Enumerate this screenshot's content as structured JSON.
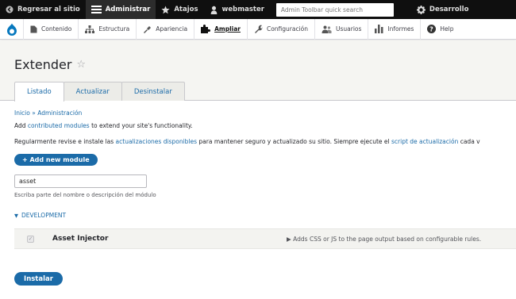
{
  "toolbar": {
    "back_label": "Regresar al sitio",
    "manage_label": "Administrar",
    "shortcuts_label": "Atajos",
    "user_label": "webmaster",
    "search_placeholder": "Admin Toolbar quick search",
    "devel_label": "Desarrollo"
  },
  "tray": {
    "items": [
      {
        "label": "Contenido",
        "icon": "file-icon"
      },
      {
        "label": "Estructura",
        "icon": "sitemap-icon"
      },
      {
        "label": "Apariencia",
        "icon": "paint-icon"
      },
      {
        "label": "Ampliar",
        "icon": "puzzle-icon"
      },
      {
        "label": "Configuración",
        "icon": "wrench-icon"
      },
      {
        "label": "Usuarios",
        "icon": "users-icon"
      },
      {
        "label": "Informes",
        "icon": "bar-chart-icon"
      },
      {
        "label": "Help",
        "icon": "help-icon"
      }
    ]
  },
  "page": {
    "title": "Extender",
    "tabs": [
      "Listado",
      "Actualizar",
      "Desinstalar"
    ]
  },
  "breadcrumb": {
    "home": "Inicio",
    "sep": " » ",
    "admin": "Administración"
  },
  "intro": {
    "p1_before": "Add ",
    "p1_link": "contributed modules",
    "p1_after": " to extend your site's functionality.",
    "p2_before": "Regularmente revise e instale las ",
    "p2_link1": "actualizaciones disponibles",
    "p2_middle": " para mantener seguro y actualizado su sitio. Siempre ejecute el ",
    "p2_link2": "script de actualización",
    "p2_after": " cada v"
  },
  "actions": {
    "add_module": "+ Add new module",
    "install": "Instalar"
  },
  "filter": {
    "value": "asset",
    "help": "Escriba parte del nombre o descripción del módulo"
  },
  "section": {
    "title": "DEVELOPMENT"
  },
  "modules": [
    {
      "name": "Asset Injector",
      "description": "Adds CSS or JS to the page output based on configurable rules."
    }
  ],
  "colors": {
    "toolbar_bg": "#0f0f0f",
    "accent": "#1b6ba8"
  }
}
